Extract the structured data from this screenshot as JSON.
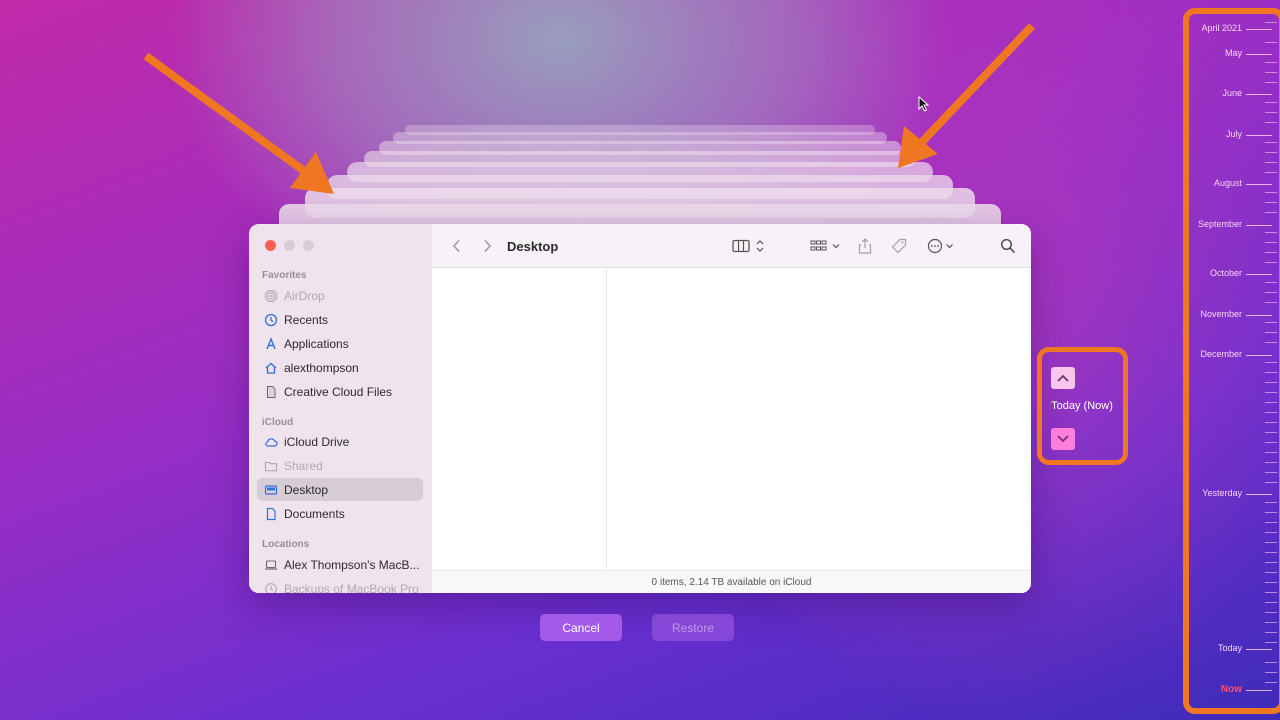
{
  "window": {
    "title": "Desktop",
    "status_text": "0 items, 2.14 TB available on iCloud"
  },
  "sidebar": {
    "favorites_header": "Favorites",
    "icloud_header": "iCloud",
    "locations_header": "Locations",
    "favorites": [
      {
        "label": "AirDrop",
        "icon": "airdrop-icon",
        "dim": true
      },
      {
        "label": "Recents",
        "icon": "clock-icon"
      },
      {
        "label": "Applications",
        "icon": "applications-icon"
      },
      {
        "label": "alexthompson",
        "icon": "home-icon"
      },
      {
        "label": "Creative Cloud Files",
        "icon": "document-icon"
      }
    ],
    "icloud": [
      {
        "label": "iCloud Drive",
        "icon": "cloud-icon"
      },
      {
        "label": "Shared",
        "icon": "shared-folder-icon",
        "dim": true
      },
      {
        "label": "Desktop",
        "icon": "desktop-icon",
        "selected": true
      },
      {
        "label": "Documents",
        "icon": "document-icon"
      }
    ],
    "locations": [
      {
        "label": "Alex Thompson's MacB...",
        "icon": "laptop-icon"
      },
      {
        "label": "Backups of MacBook Pro",
        "icon": "time-machine-icon",
        "dim": true
      }
    ]
  },
  "buttons": {
    "cancel": "Cancel",
    "restore": "Restore"
  },
  "navigator": {
    "label": "Today (Now)"
  },
  "timeline": {
    "labels": [
      "April 2021",
      "May",
      "June",
      "July",
      "August",
      "September",
      "October",
      "November",
      "December",
      "Yesterday",
      "Today",
      "Now"
    ]
  },
  "colors": {
    "annotation_orange": "#f07722",
    "accent_purple": "#a35ae8",
    "now_red": "#ff4d6a"
  }
}
